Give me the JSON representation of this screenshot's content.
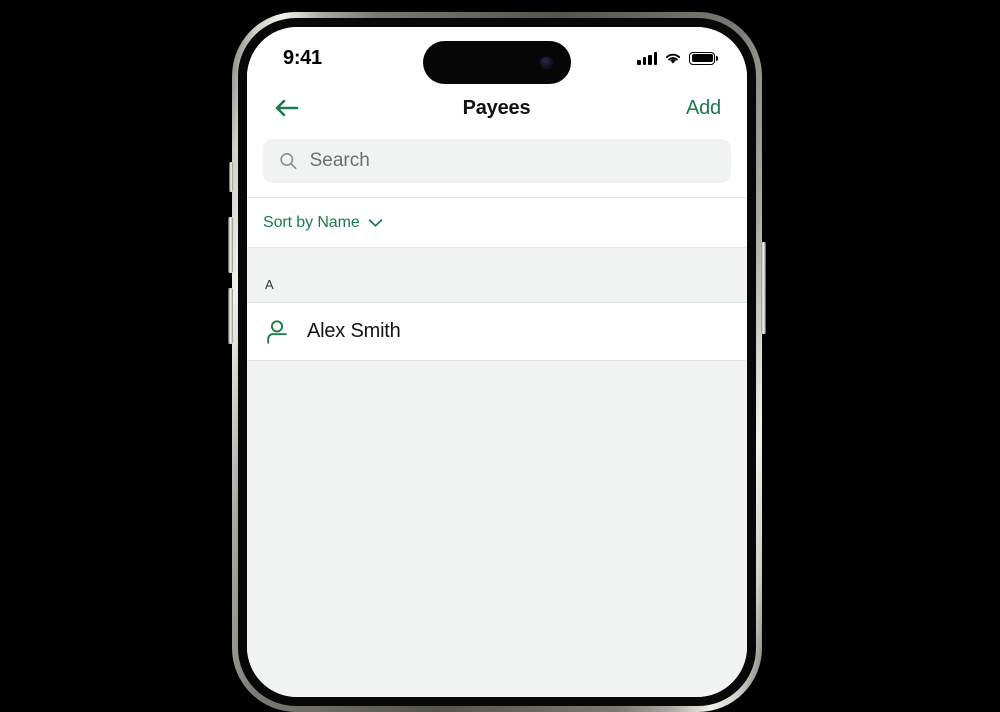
{
  "status_bar": {
    "time": "9:41",
    "icons": {
      "cellular": "cellular-signal-icon",
      "wifi": "wifi-icon",
      "battery": "battery-full-icon"
    }
  },
  "nav_bar": {
    "back_icon": "arrow-left-icon",
    "title": "Payees",
    "add_label": "Add"
  },
  "search": {
    "icon": "search-icon",
    "placeholder": "Search",
    "value": ""
  },
  "sort": {
    "label": "Sort by Name",
    "chevron_icon": "chevron-down-icon"
  },
  "sections": [
    {
      "letter": "A",
      "payees": [
        {
          "icon": "person-outline-icon",
          "name": "Alex Smith"
        }
      ]
    }
  ],
  "colors": {
    "accent_green": "#1c7a4c",
    "list_background": "#f1f2f2",
    "card_background": "#ffffff",
    "divider": "#e2e3e3",
    "primary_text": "#141414",
    "placeholder_text": "#6d6d6d"
  }
}
